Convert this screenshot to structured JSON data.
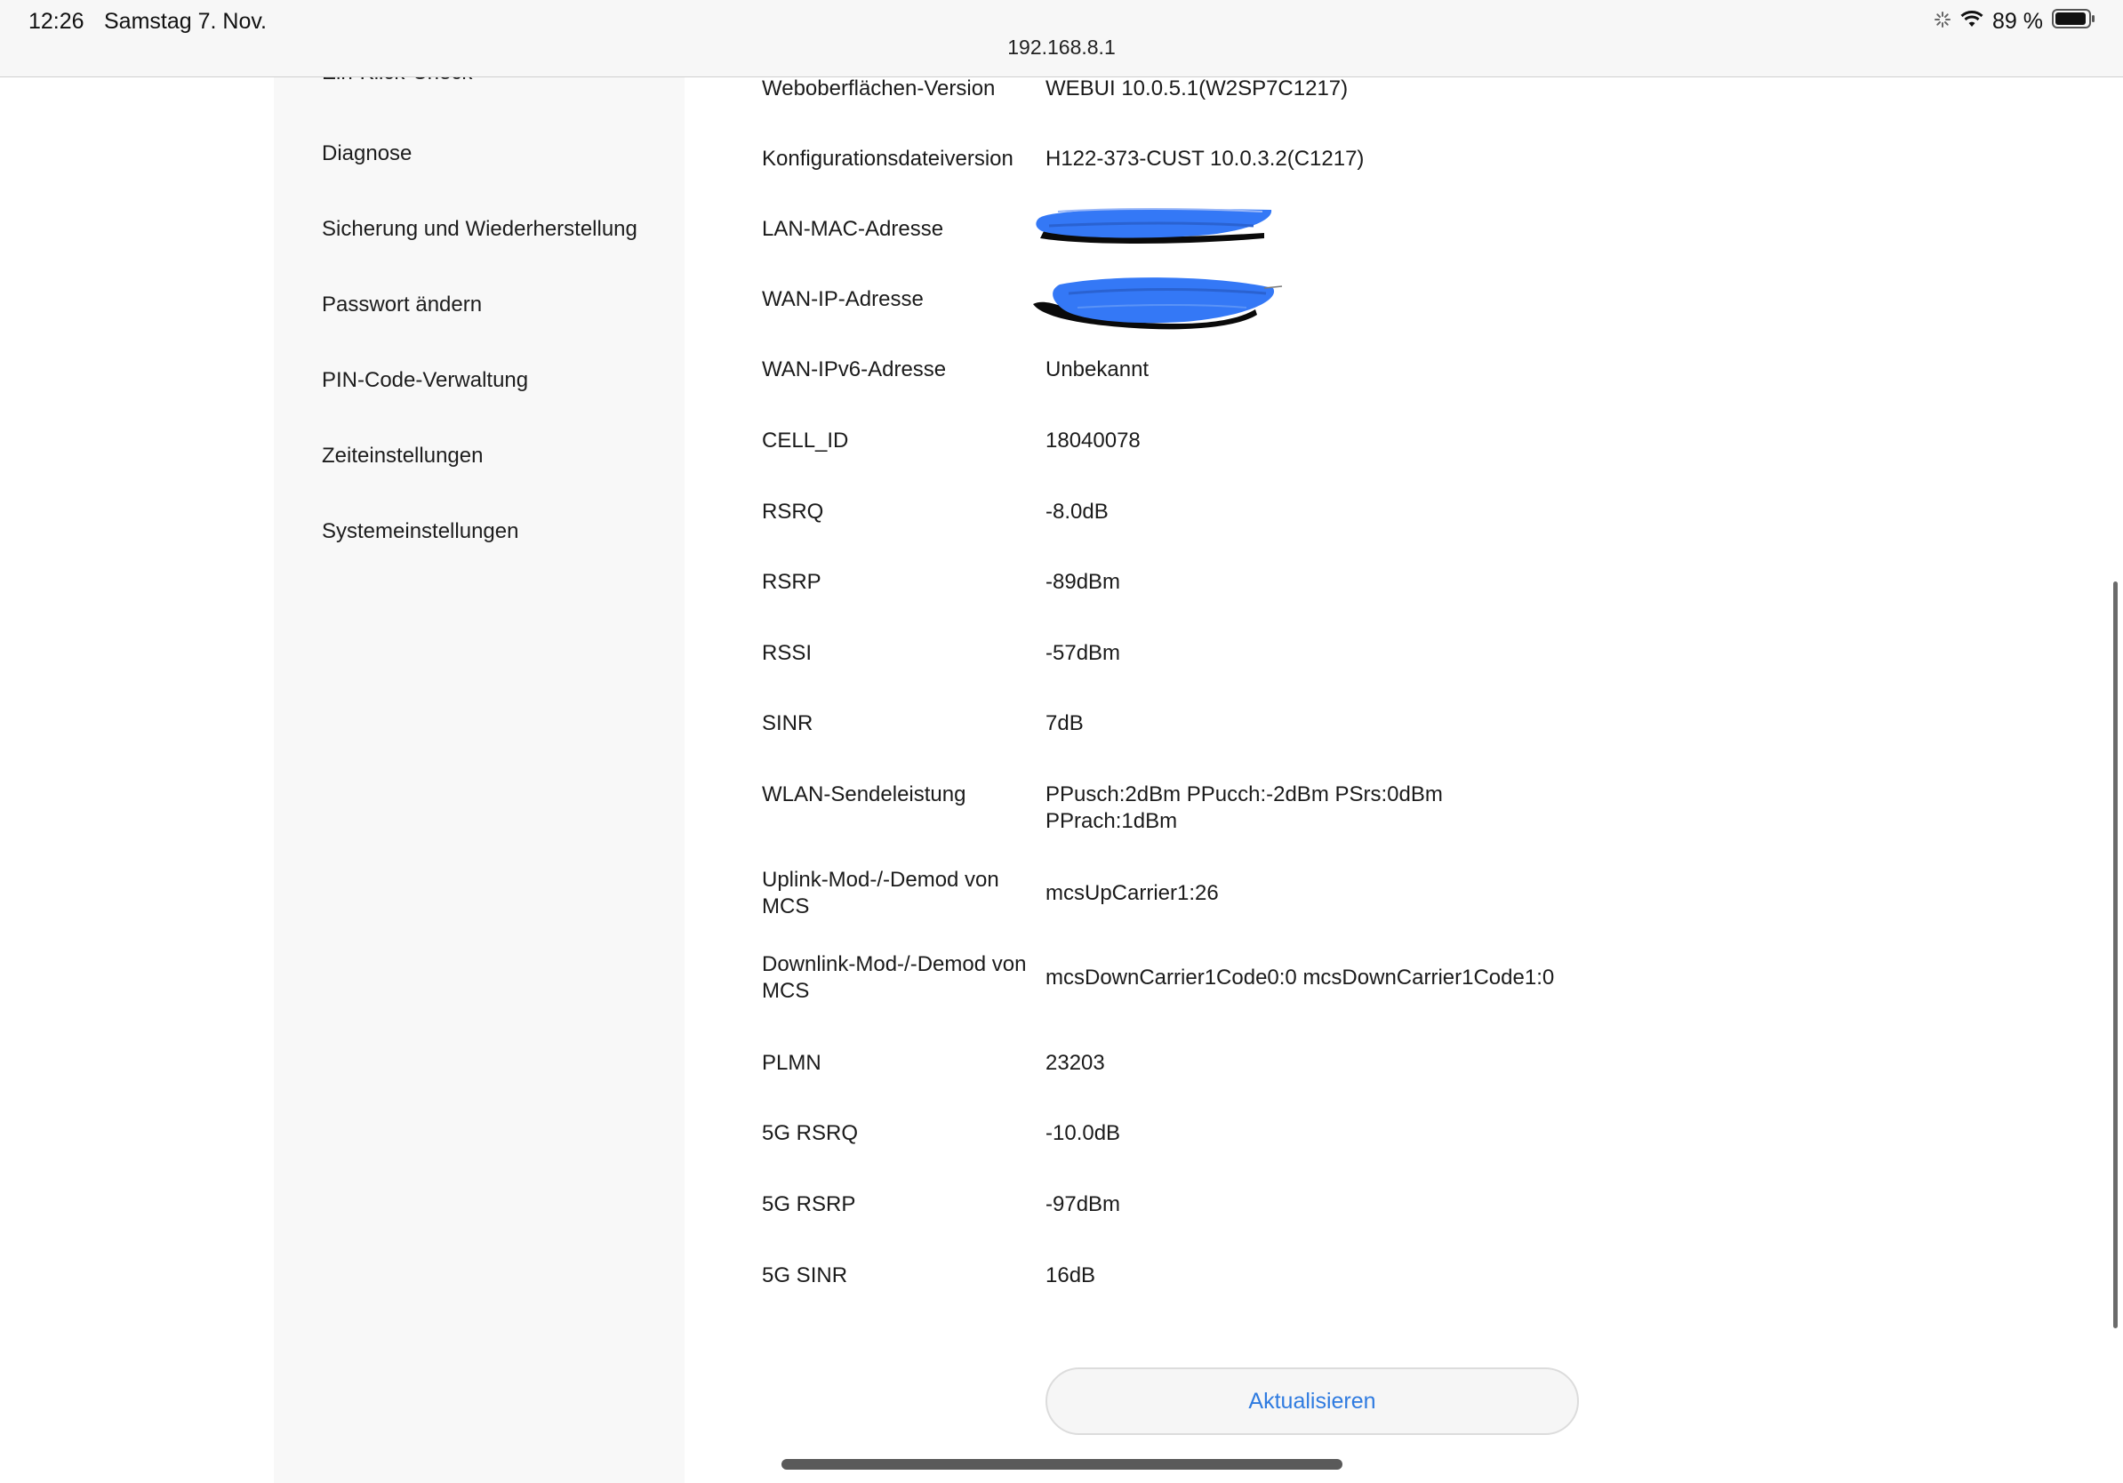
{
  "status_bar": {
    "time": "12:26",
    "date": "Samstag 7. Nov.",
    "battery": "89 %"
  },
  "address_bar": {
    "url": "192.168.8.1"
  },
  "sidebar": {
    "items": [
      {
        "label": "Ein-Klick-Check"
      },
      {
        "label": "Diagnose"
      },
      {
        "label": "Sicherung und Wiederherstellung"
      },
      {
        "label": "Passwort ändern"
      },
      {
        "label": "PIN-Code-Verwaltung"
      },
      {
        "label": "Zeiteinstellungen"
      },
      {
        "label": "Systemeinstellungen"
      }
    ]
  },
  "device_info": {
    "rows": [
      {
        "label": "Weboberflächen-Version",
        "value": "WEBUI 10.0.5.1(W2SP7C1217)"
      },
      {
        "label": "Konfigurationsdateiversion",
        "value": "H122-373-CUST 10.0.3.2(C1217)"
      },
      {
        "label": "LAN-MAC-Adresse",
        "value": ""
      },
      {
        "label": "WAN-IP-Adresse",
        "value": ""
      },
      {
        "label": "WAN-IPv6-Adresse",
        "value": "Unbekannt"
      },
      {
        "label": "CELL_ID",
        "value": "18040078"
      },
      {
        "label": "RSRQ",
        "value": "-8.0dB"
      },
      {
        "label": "RSRP",
        "value": "-89dBm"
      },
      {
        "label": "RSSI",
        "value": "-57dBm"
      },
      {
        "label": "SINR",
        "value": "7dB"
      },
      {
        "label": "WLAN-Sendeleistung",
        "value": "PPusch:2dBm PPucch:-2dBm PSrs:0dBm PPrach:1dBm"
      },
      {
        "label": "Uplink-Mod-/-Demod von MCS",
        "value": "mcsUpCarrier1:26"
      },
      {
        "label": "Downlink-Mod-/-Demod von MCS",
        "value": "mcsDownCarrier1Code0:0 mcsDownCarrier1Code1:0"
      },
      {
        "label": "PLMN",
        "value": "23203"
      },
      {
        "label": "5G RSRQ",
        "value": "-10.0dB"
      },
      {
        "label": "5G RSRP",
        "value": "-97dBm"
      },
      {
        "label": "5G SINR",
        "value": "16dB"
      }
    ],
    "refresh_label": "Aktualisieren"
  },
  "colors": {
    "link_blue": "#2f7be0",
    "redaction_blue": "#3478f6",
    "redaction_black": "#0a0a0a"
  },
  "icons": [
    "activity-spinner-icon",
    "wifi-icon",
    "battery-icon"
  ]
}
